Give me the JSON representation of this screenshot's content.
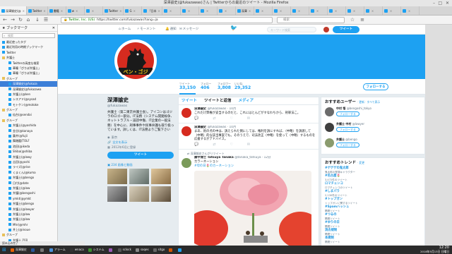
{
  "window": {
    "title": "深澤諭史(@fukazawas)さん | Twitterからの最近のツイート - Mozilla Firefox"
  },
  "tabs": [
    {
      "label": "深澤諭史(@"
    },
    {
      "label": "Twitter"
    },
    {
      "label": "書籍"
    },
    {
      "label": "w"
    },
    {
      "label": ""
    },
    {
      "label": "Twitter"
    },
    {
      "label": "G"
    },
    {
      "label": "「日本"
    },
    {
      "label": ""
    },
    {
      "label": ""
    },
    {
      "label": ""
    },
    {
      "label": ""
    },
    {
      "label": "深澤"
    },
    {
      "label": ""
    },
    {
      "label": ""
    },
    {
      "label": ""
    },
    {
      "label": ""
    },
    {
      "label": ""
    },
    {
      "label": ""
    },
    {
      "label": ""
    },
    {
      "label": ""
    },
    {
      "label": ""
    }
  ],
  "urlbar": {
    "secure_label": "Twitter, Inc. (US)",
    "url": "https://twitter.com/fukazawas?lang=ja"
  },
  "searchbar": {
    "placeholder": "検索"
  },
  "sidebar": {
    "title": "ブックマーク",
    "search_placeholder": "検索",
    "items": [
      {
        "label": "最近使ったタグ",
        "sel": false
      },
      {
        "label": "最近利用の時期ブックマーク",
        "sel": false
      },
      {
        "label": "Twitter",
        "sel": false
      },
      {
        "label": "弁護士",
        "sel": false
      },
      {
        "label": "Twitterの高度な検索",
        "sel": false
      },
      {
        "label": "華瞳「ぴりぽ弁護士」",
        "sel": false
      },
      {
        "label": "華瞳「ぴりぽ弁護士」",
        "sel": false
      },
      {
        "label": "グループ",
        "sel": false
      },
      {
        "label": "深澤諭史(@fukaza",
        "sel": true
      },
      {
        "label": "深澤諭史(@fukazawa",
        "sel": false
      },
      {
        "label": "弁護士(@ben",
        "sel": false
      },
      {
        "label": "シスアド(@sysad",
        "sel": false
      },
      {
        "label": "モトケン(@motoke",
        "sel": false
      },
      {
        "label": "グループ",
        "sel": false
      },
      {
        "label": "仙台(@sendai",
        "sel": false
      },
      {
        "label": "グループ",
        "sel": false
      },
      {
        "label": "弁護士(@yoshida",
        "sel": false
      },
      {
        "label": "金谷(@kanaya",
        "sel": false
      },
      {
        "label": "藤井(@fujii",
        "sel": false
      },
      {
        "label": "舞踏鑑(TOLF",
        "sel": false
      },
      {
        "label": "池田(@ikeda",
        "sel": false
      },
      {
        "label": "Shiba(@shiba",
        "sel": false
      },
      {
        "label": "弁護士(@lawy",
        "sel": false
      },
      {
        "label": "吉田(@yoshi",
        "sel": false
      },
      {
        "label": "ライズ(@rise",
        "sel": false
      },
      {
        "label": "くまくん(@kuma",
        "sel": false
      },
      {
        "label": "弁護士(@bengo",
        "sel": false
      },
      {
        "label": "日付(@date",
        "sel": false
      },
      {
        "label": "弁護士(@law",
        "sel": false
      },
      {
        "label": "弁護(@bengoshi",
        "sel": false
      },
      {
        "label": "ymkt(@ymkt",
        "sel": false
      },
      {
        "label": "弁護士(@bengo",
        "sel": false
      },
      {
        "label": "弁護士(@lawyer",
        "sel": false
      },
      {
        "label": "弁護士(@law",
        "sel": false
      },
      {
        "label": "弁護士(@law",
        "sel": false
      },
      {
        "label": "Mhr(@mhr",
        "sel": false
      },
      {
        "label": "井上(@inoue",
        "sel": false
      },
      {
        "label": "グループ",
        "sel": false
      },
      {
        "label": "弁護士 戸田",
        "sel": false
      },
      {
        "label": "ymkt(@ymkt",
        "sel": false
      },
      {
        "label": "グループ",
        "sel": false
      }
    ]
  },
  "twitter": {
    "nav": {
      "home": "ホーム",
      "moments": "モーメント",
      "notifications": "通知",
      "messages": "メッセージ"
    },
    "search_placeholder": "キーワード検索",
    "tweet_button": "ツイート",
    "stats": [
      {
        "label": "ツイート",
        "value": "33,150"
      },
      {
        "label": "フォロー",
        "value": "406"
      },
      {
        "label": "フォロワー",
        "value": "3,808"
      },
      {
        "label": "いいね",
        "value": "29,352"
      }
    ],
    "follow_button": "フォローする",
    "avatar_caption": "ベン・ゴジ",
    "profile": {
      "name": "深澤諭史",
      "handle": "@fukazawas",
      "bio": "弁護士（第二東京弁護士会）。アイコンはゴジラのロゴ一部分。IT法務（システム開発紛争、ネットトラブル・誹謗中傷、IT企業の一般法務）を中心に、刑事事件や民事弁護も取り扱っています。詳しくは、IT法務よりご覧下さい",
      "location": "東京",
      "link": "全文を表示",
      "joined": "2012年6月に登録",
      "tweet_to": "ツイート",
      "photos_link": "234 画像と動画"
    },
    "timeline": {
      "tabs": [
        "ツイート",
        "ツイートと返信",
        "メディア"
      ],
      "tweets": [
        {
          "name": "深澤諭史",
          "handle": "@fukazawas · 10月",
          "text": "これだけ弊権が妥当するのだと、これにはとんどがすなわちから、刑罪法こ。"
        },
        {
          "name": "深澤諭史",
          "handle": "@fukazawas · 10月",
          "text": "まあ、刑の点の中は、訴えられた側にしては、権利を訴にすれば、（中略）を訴渡して（中略）的な該当事案でも。そのうえで、司法改正（中略）を使って（中略）するものを応援するがアドバイス。"
        },
        {
          "retweet_note": "深澤諭史さんがリツイート",
          "name": "廣中博士 Tatsuya Tanaka",
          "handle": "@tanaka_tatsuya · 12分",
          "text": "カラーネーション",
          "tag": "#母の日🌷のカーネーション"
        }
      ]
    },
    "who_to_follow": {
      "title": "おすすめユーザー",
      "links": "· 更新 · すべて表示",
      "users": [
        {
          "name": "中村 悟",
          "handle": "@bengoshi_tokyo",
          "button": "フォローする"
        },
        {
          "name": "弁護士 中村",
          "handle": "@lawyer",
          "button": "フォローする"
        },
        {
          "name": "弁護士",
          "handle": "@bengo",
          "button": "フォローする"
        }
      ]
    },
    "trends": {
      "title": "おすすめトレンド",
      "links": "· 変更",
      "items": [
        {
          "name": "#ゲゲゲの鬼太郎",
          "desc": "鬼太郎の登場キャラクター"
        },
        {
          "name": "#名古屋🌷",
          "desc": "3,472件のツイート"
        },
        {
          "name": "ロマチェンコ",
          "desc": "ロマチェンコのツイート"
        },
        {
          "name": "#しまパラ",
          "desc": "2,130件のツイート"
        },
        {
          "name": "#トップガン",
          "desc": "トップガンに関するツイート"
        },
        {
          "name": "#Spamハッシュ",
          "desc": "関連ツイート"
        },
        {
          "name": "#つるの",
          "desc": "関連ツイート"
        },
        {
          "name": "#ゆりの日",
          "desc": "関連ツイート"
        },
        {
          "name": "消去規制",
          "desc": "関連ツイート"
        },
        {
          "name": "本規制",
          "desc": "関連ツイート"
        }
      ]
    }
  },
  "statusbar": {
    "text": "読み込み完了"
  },
  "taskbar": {
    "items": [
      {
        "label": "深澤諭史",
        "color": "#e66000"
      },
      {
        "label": "",
        "color": "#2b579a"
      },
      {
        "label": "",
        "color": "#777777"
      },
      {
        "label": "アラーム",
        "color": "#4a90d9"
      },
      {
        "label": "wnaca",
        "color": "#333333"
      },
      {
        "label": "システム",
        "color": "#3c8d2f"
      },
      {
        "label": "",
        "color": "#9b59b6"
      },
      {
        "label": "sclock",
        "color": "#555555"
      },
      {
        "label": "saqes",
        "color": "#888888"
      },
      {
        "label": "sitgo",
        "color": "#666666"
      },
      {
        "label": "",
        "color": "#d35400"
      },
      {
        "label": "",
        "color": "#1da1f2"
      }
    ],
    "time": "12:20",
    "date": "2018年5月13日 日曜日"
  },
  "colors": {
    "twitter_blue": "#1da1f2",
    "link_blue": "#1b95e0",
    "muted": "#657786"
  }
}
